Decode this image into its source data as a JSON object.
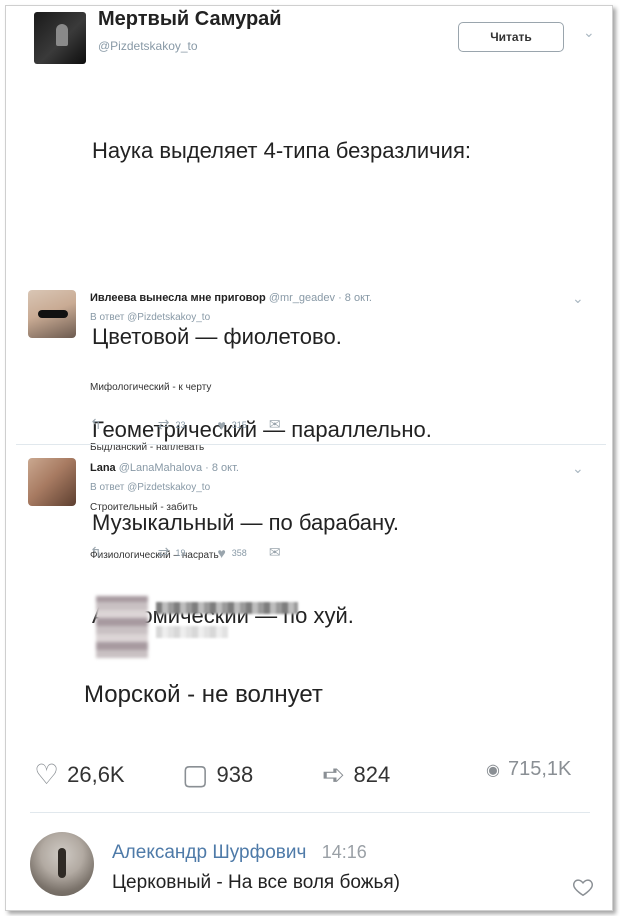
{
  "tweet": {
    "author_name": "Мертвый Самурай",
    "author_handle": "@Pizdetskakoy_to",
    "follow_label": "Читать",
    "lines": [
      "Наука выделяет 4-типа безразличия:",
      "",
      "Цветовой — фиолетово.",
      "Геометрический — параллельно.",
      "Музыкальный — по барабану.",
      "Анатомический — по хуй."
    ]
  },
  "replies": [
    {
      "name": "Ивлеева вынесла мне приговор",
      "handle": "@mr_geadev",
      "date": "· 8 окт.",
      "reply_to": "В ответ @Pizdetskakoy_to",
      "text_lines": [
        "Мифологический - к черту",
        "Быдланский - наплевать",
        "Строительный - забить"
      ],
      "retweets": "23",
      "likes": "315"
    },
    {
      "name": "Lana",
      "handle": "@LanaMahalova",
      "date": "· 8 окт.",
      "reply_to": "В ответ @Pizdetskakoy_to",
      "text_lines": [
        "Физиологический – насрать"
      ],
      "retweets": "19",
      "likes": "358"
    }
  ],
  "vk_post": {
    "text": "Морской - не волнует",
    "likes": "26,6K",
    "comments": "938",
    "shares": "824",
    "views": "715,1K"
  },
  "comment": {
    "author": "Александр Шурфович",
    "time": "14:16",
    "text": "Церковный - На все воля божья)"
  },
  "icons": {
    "reply": "reply-icon",
    "retweet": "retweet-icon",
    "like": "heart-icon",
    "dm": "message-icon"
  }
}
